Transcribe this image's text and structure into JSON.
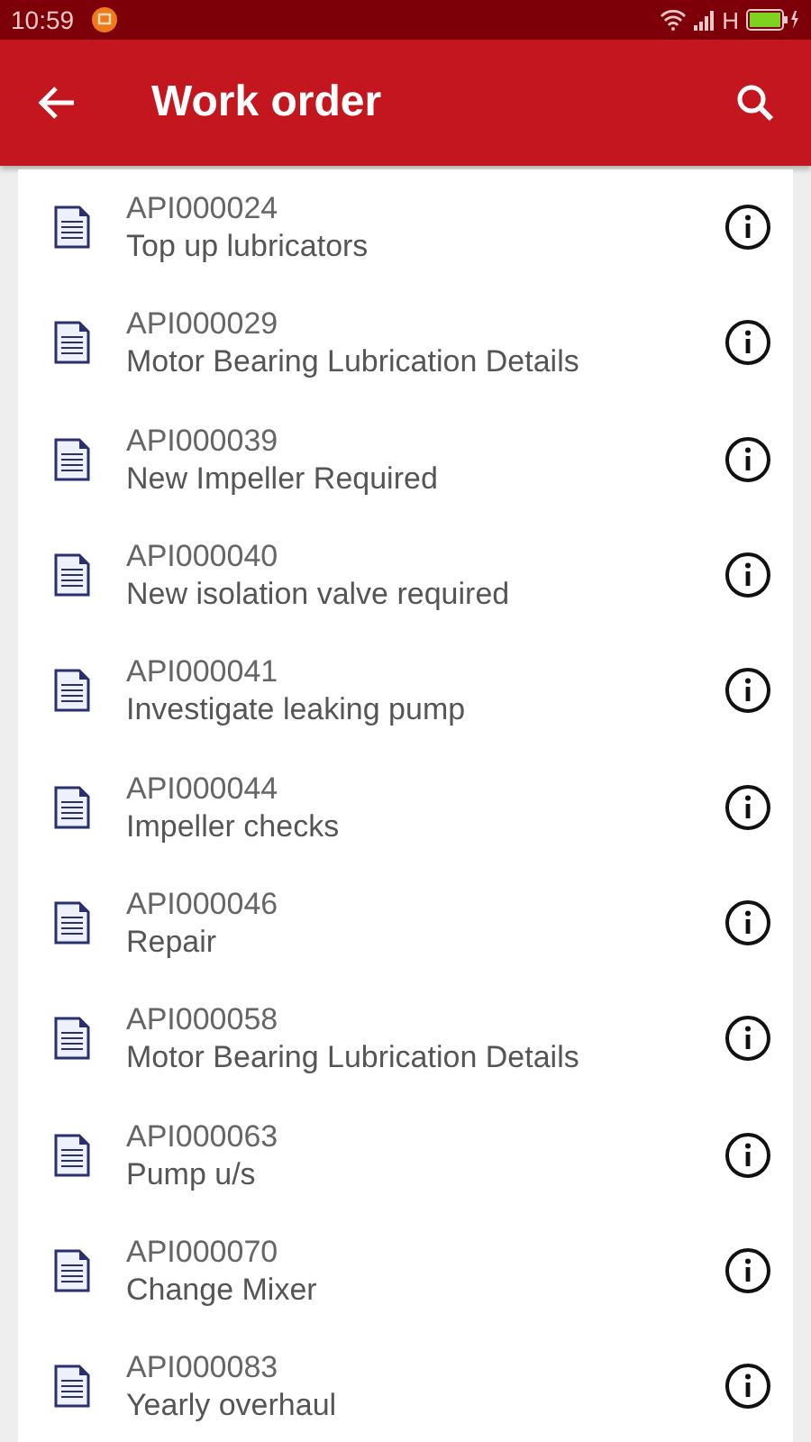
{
  "status_bar": {
    "time": "10:59",
    "network": "H"
  },
  "app_bar": {
    "title": "Work order"
  },
  "work_orders": [
    {
      "id": "API000024",
      "description": "Top up lubricators"
    },
    {
      "id": "API000029",
      "description": "Motor Bearing Lubrication Details"
    },
    {
      "id": "API000039",
      "description": "New Impeller Required"
    },
    {
      "id": "API000040",
      "description": "New isolation valve required"
    },
    {
      "id": "API000041",
      "description": "Investigate leaking pump"
    },
    {
      "id": "API000044",
      "description": "Impeller checks"
    },
    {
      "id": "API000046",
      "description": "Repair"
    },
    {
      "id": "API000058",
      "description": "Motor Bearing Lubrication Details"
    },
    {
      "id": "API000063",
      "description": "Pump u/s"
    },
    {
      "id": "API000070",
      "description": "Change Mixer"
    },
    {
      "id": "API000083",
      "description": "Yearly overhaul"
    }
  ]
}
